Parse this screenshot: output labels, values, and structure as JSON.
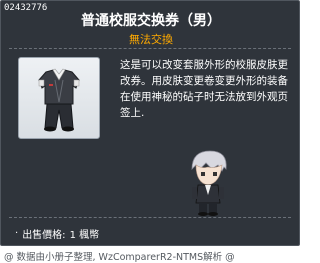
{
  "item": {
    "id": "02432776",
    "name": "普通校服交换券（男）",
    "trade_status": "無法交換",
    "description": "这是可以改变套服外形的校服皮肤更改券。用皮肤变更卷变更外形的装备在使用神秘的砧子时无法放到外观页签上.",
    "price_label": "出售價格:",
    "price_value": "1 楓幣"
  },
  "footer": {
    "credit": "@ 数据由小册子整理, WzComparerR2-NTMS解析 @"
  },
  "colors": {
    "background": "#2f343b",
    "title": "#ffffff",
    "trade_status": "#ffaa00",
    "text": "#ffffff"
  },
  "icons": {
    "item_icon": "school-uniform-icon",
    "character_preview": "character-preview"
  }
}
